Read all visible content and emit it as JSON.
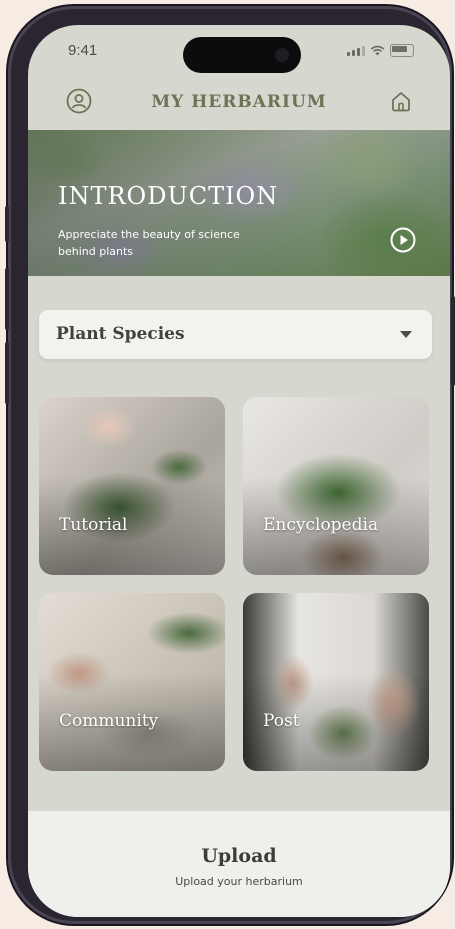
{
  "status_bar": {
    "time": "9:41",
    "icons": [
      "signal-icon",
      "wifi-icon",
      "battery-icon"
    ]
  },
  "header": {
    "title": "MY HERBARIUM",
    "left_icon": "user-icon",
    "right_icon": "home-icon"
  },
  "hero": {
    "title": "INTRODUCTION",
    "subtitle": "Appreciate the beauty of science behind plants",
    "action_icon": "play-icon"
  },
  "dropdown": {
    "selected": "Plant Species",
    "icon": "caret-down-icon"
  },
  "cards": [
    {
      "label": "Tutorial"
    },
    {
      "label": "Encyclopedia"
    },
    {
      "label": "Community"
    },
    {
      "label": "Post"
    }
  ],
  "upload": {
    "title": "Upload",
    "subtitle": "Upload your herbarium"
  },
  "colors": {
    "accent": "#6e7356",
    "background": "#d6d8cf",
    "frame": "#2a2530"
  }
}
